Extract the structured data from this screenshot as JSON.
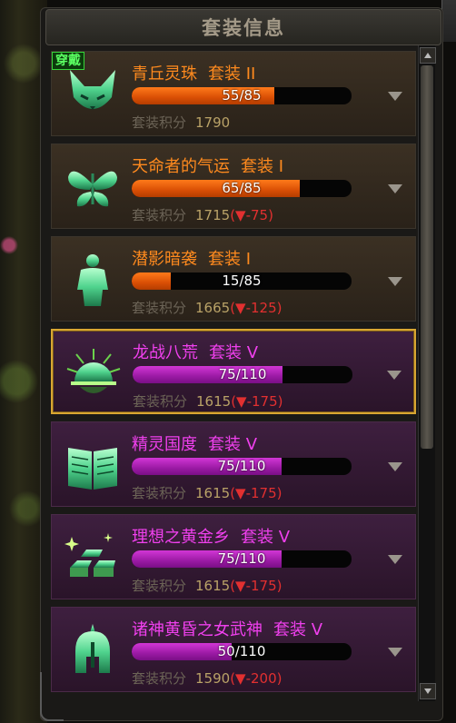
{
  "panel": {
    "title": "套装信息"
  },
  "wear_badge": "穿戴",
  "score_label": "套装积分",
  "items": [
    {
      "name": "青丘灵珠",
      "tier": "套装 II",
      "progress_text": "55/85",
      "progress_fraction": 0.647,
      "score": "1790",
      "diff": "",
      "theme": "orange",
      "icon": "fox-mask-icon",
      "worn": true,
      "selected": false
    },
    {
      "name": "天命者的气运",
      "tier": "套装 I",
      "progress_text": "65/85",
      "progress_fraction": 0.765,
      "score": "1715",
      "diff": "(▼-75)",
      "theme": "orange",
      "icon": "butterfly-icon",
      "worn": false,
      "selected": false
    },
    {
      "name": "潜影暗袭",
      "tier": "套装 I",
      "progress_text": "15/85",
      "progress_fraction": 0.176,
      "score": "1665",
      "diff": "(▼-125)",
      "theme": "orange",
      "icon": "body-silhouette-icon",
      "worn": false,
      "selected": false
    },
    {
      "name": "龙战八荒",
      "tier": "套装 V",
      "progress_text": "75/110",
      "progress_fraction": 0.682,
      "score": "1615",
      "diff": "(▼-175)",
      "theme": "magenta",
      "icon": "rising-sun-icon",
      "worn": false,
      "selected": true
    },
    {
      "name": "精灵国度",
      "tier": "套装 V",
      "progress_text": "75/110",
      "progress_fraction": 0.682,
      "score": "1615",
      "diff": "(▼-175)",
      "theme": "magenta",
      "icon": "open-book-icon",
      "worn": false,
      "selected": false
    },
    {
      "name": "理想之黄金乡",
      "tier": "套装 V",
      "progress_text": "75/110",
      "progress_fraction": 0.682,
      "score": "1615",
      "diff": "(▼-175)",
      "theme": "magenta",
      "icon": "gold-bars-icon",
      "worn": false,
      "selected": false
    },
    {
      "name": "诸神黄昏之女武神",
      "tier": "套装 V",
      "progress_text": "50/110",
      "progress_fraction": 0.455,
      "score": "1590",
      "diff": "(▼-200)",
      "theme": "magenta",
      "icon": "helmet-icon",
      "worn": false,
      "selected": false
    }
  ],
  "colors": {
    "orange_title": "#ff8a1e",
    "magenta_title": "#f040ee",
    "selected_border": "#d9a632",
    "diff_red": "#e23030",
    "score_gold": "#b9a267"
  }
}
